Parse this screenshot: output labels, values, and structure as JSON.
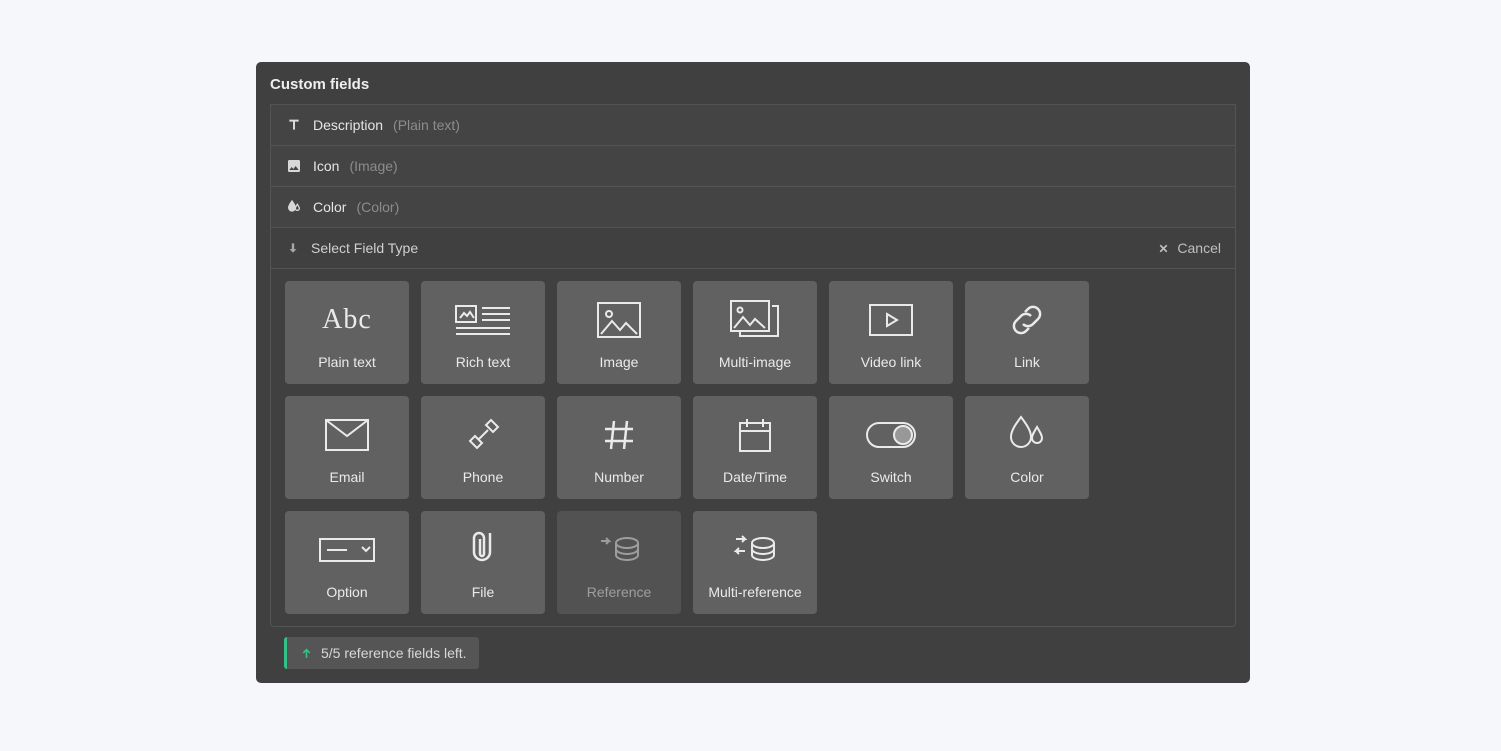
{
  "panel": {
    "title": "Custom fields",
    "fields": [
      {
        "label": "Description",
        "hint": "(Plain text)",
        "icon": "text"
      },
      {
        "label": "Icon",
        "hint": "(Image)",
        "icon": "image"
      },
      {
        "label": "Color",
        "hint": "(Color)",
        "icon": "color"
      }
    ],
    "selectRow": {
      "label": "Select Field Type",
      "cancel": "Cancel"
    },
    "types": [
      {
        "id": "plain-text",
        "label": "Plain text",
        "icon": "abc"
      },
      {
        "id": "rich-text",
        "label": "Rich text",
        "icon": "richtext"
      },
      {
        "id": "image",
        "label": "Image",
        "icon": "image-lg"
      },
      {
        "id": "multi-image",
        "label": "Multi-image",
        "icon": "multi-image"
      },
      {
        "id": "video-link",
        "label": "Video link",
        "icon": "video"
      },
      {
        "id": "link",
        "label": "Link",
        "icon": "link"
      },
      {
        "id": "email",
        "label": "Email",
        "icon": "email"
      },
      {
        "id": "phone",
        "label": "Phone",
        "icon": "phone"
      },
      {
        "id": "number",
        "label": "Number",
        "icon": "number"
      },
      {
        "id": "datetime",
        "label": "Date/Time",
        "icon": "calendar"
      },
      {
        "id": "switch",
        "label": "Switch",
        "icon": "switch"
      },
      {
        "id": "color",
        "label": "Color",
        "icon": "color-lg"
      },
      {
        "id": "option",
        "label": "Option",
        "icon": "option"
      },
      {
        "id": "file",
        "label": "File",
        "icon": "file"
      },
      {
        "id": "reference",
        "label": "Reference",
        "icon": "reference",
        "disabled": true
      },
      {
        "id": "multi-reference",
        "label": "Multi-reference",
        "icon": "multi-reference"
      }
    ],
    "quota": "5/5 reference fields left."
  }
}
